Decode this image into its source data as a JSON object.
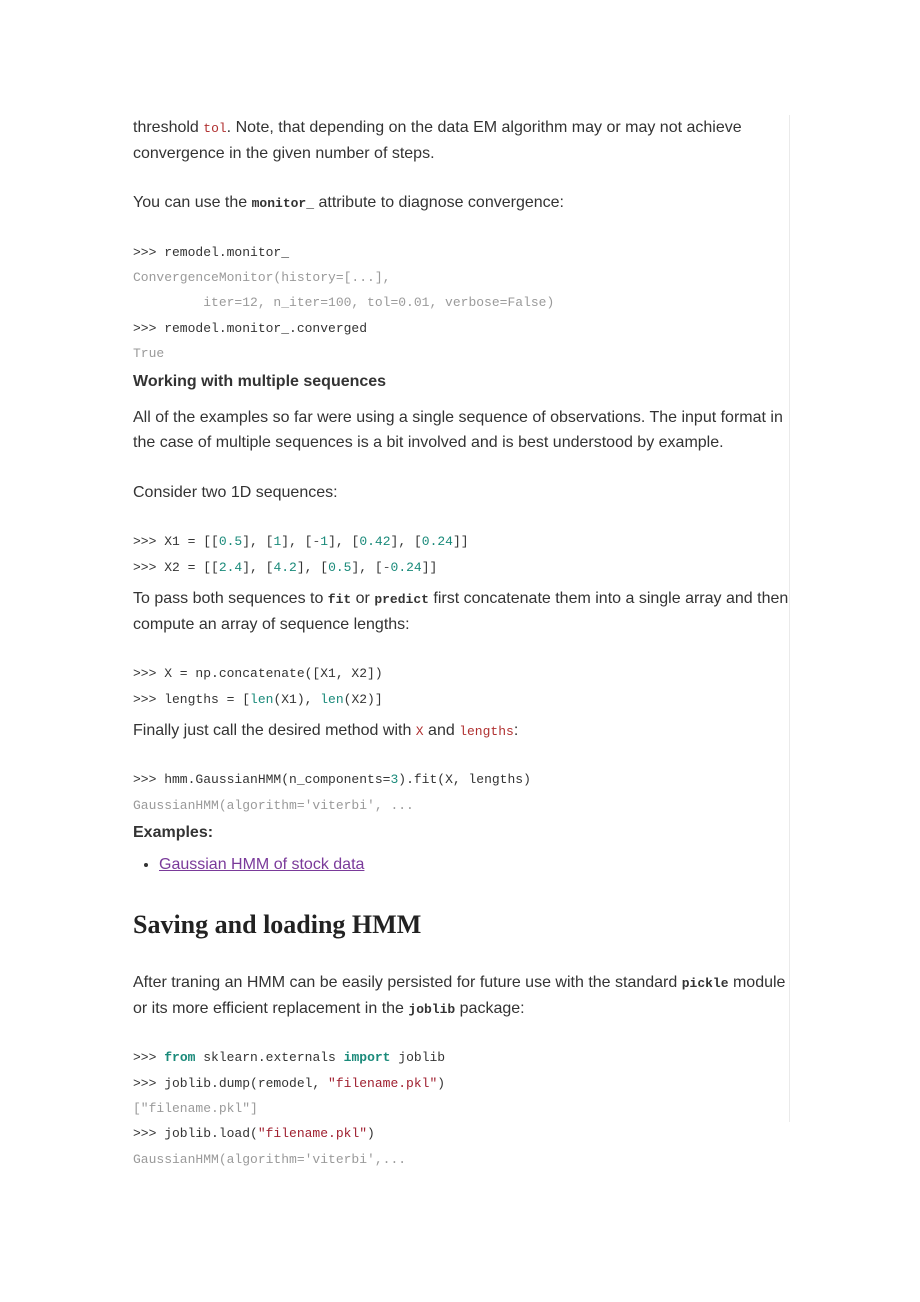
{
  "para1_a": "threshold ",
  "para1_tol": "tol",
  "para1_b": ". Note, that depending on the data EM algorithm may or may not achieve convergence in the given number of steps.",
  "para2_a": "You can use the ",
  "para2_mon": "monitor_",
  "para2_b": " attribute to diagnose convergence:",
  "code1_l1": ">>> remodel.monitor_",
  "code1_l2": "ConvergenceMonitor(history=[...],",
  "code1_l3": "         iter=12, n_iter=100, tol=0.01, verbose=False)",
  "code1_l4": ">>> remodel.monitor_.converged",
  "code1_l5": "True",
  "h_multi": "Working with multiple sequences",
  "para3": "All of the examples so far were using a single sequence of observations. The input format in the case of multiple sequences is a bit involved and is best understood by example.",
  "para4": "Consider two 1D sequences:",
  "code2_vals": {
    "x1": [
      0.5,
      1.0,
      -1.0,
      0.42,
      0.24
    ],
    "x2": [
      2.4,
      4.2,
      0.5,
      -0.24
    ]
  },
  "para5_a": "To pass both sequences to ",
  "para5_fit": "fit",
  "para5_b": " or ",
  "para5_pred": "predict",
  "para5_c": " first concatenate them into a single array and then compute an array of sequence lengths:",
  "code3_l1": ">>> X = np.concatenate([X1, X2])",
  "code3_l2a": ">>> lengths = [",
  "code3_len": "len",
  "code3_l2b": "(X1), ",
  "code3_l2c": "(X2)]",
  "para6_a": "Finally just call the desired method with ",
  "para6_x": "X",
  "para6_b": " and ",
  "para6_len": "lengths",
  "para6_c": ":",
  "code4_l1a": ">>> hmm.GaussianHMM(n_components=",
  "code4_l1n": "3",
  "code4_l1b": ").fit(X, lengths)",
  "code4_l2": "GaussianHMM(algorithm='viterbi', ...",
  "h_examples": "Examples:",
  "link_text": "Gaussian HMM of stock data",
  "h_saving": "Saving and loading HMM",
  "para7_a": "After traning an HMM can be easily persisted for future use with the standard ",
  "para7_pickle": "pickle",
  "para7_b": " module or its more efficient replacement in the ",
  "para7_joblib": "joblib",
  "para7_c": " package:",
  "code5_p": ">>> ",
  "code5_from": "from",
  "code5_mod": " sklearn.externals ",
  "code5_import": "import",
  "code5_jl": " joblib",
  "code5_l2a": ">>> joblib.dump(remodel, ",
  "code5_l2s": "\"filename.pkl\"",
  "code5_l2b": ")",
  "code5_l3": "[\"filename.pkl\"]",
  "code5_l4a": ">>> joblib.load(",
  "code5_l4s": "\"filename.pkl\"",
  "code5_l4b": ")",
  "code5_l5": "GaussianHMM(algorithm='viterbi',...",
  "chart_data": {
    "type": "table",
    "title": "Example 1D sequences X1 and X2",
    "series": [
      {
        "name": "X1",
        "values": [
          0.5,
          1.0,
          -1.0,
          0.42,
          0.24
        ]
      },
      {
        "name": "X2",
        "values": [
          2.4,
          4.2,
          0.5,
          -0.24
        ]
      }
    ]
  }
}
